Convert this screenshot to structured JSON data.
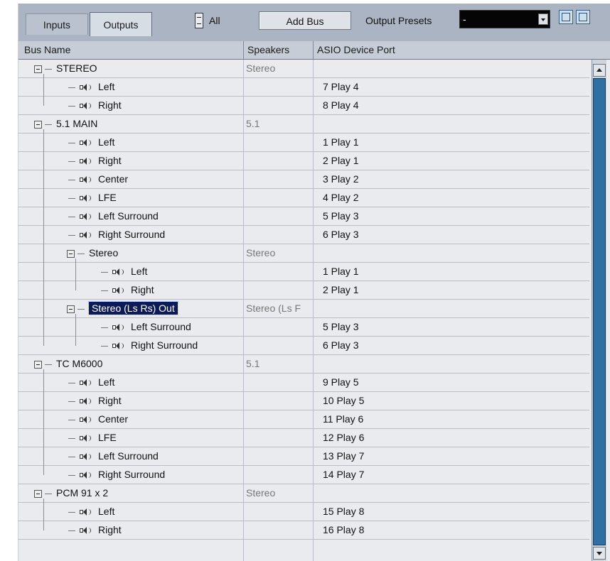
{
  "toolbar": {
    "tabs": [
      {
        "label": "Inputs",
        "active": false
      },
      {
        "label": "Outputs",
        "active": true
      }
    ],
    "all_label": "All",
    "add_bus_label": "Add Bus",
    "presets_label": "Output Presets",
    "presets_value": "-"
  },
  "columns": {
    "bus_name": "Bus Name",
    "speakers": "Speakers",
    "asio_port": "ASIO Device Port"
  },
  "rows": [
    {
      "level": 0,
      "kind": "bus",
      "name": "STEREO",
      "speakers": "Stereo",
      "port": ""
    },
    {
      "level": 1,
      "kind": "channel",
      "name": "Left",
      "speakers": "",
      "port": "7 Play 4"
    },
    {
      "level": 1,
      "kind": "channel",
      "name": "Right",
      "speakers": "",
      "port": "8 Play 4"
    },
    {
      "level": 0,
      "kind": "bus",
      "name": "5.1 MAIN",
      "speakers": "5.1",
      "port": ""
    },
    {
      "level": 1,
      "kind": "channel",
      "name": "Left",
      "speakers": "",
      "port": "1 Play 1"
    },
    {
      "level": 1,
      "kind": "channel",
      "name": "Right",
      "speakers": "",
      "port": "2 Play 1"
    },
    {
      "level": 1,
      "kind": "channel",
      "name": "Center",
      "speakers": "",
      "port": "3 Play 2"
    },
    {
      "level": 1,
      "kind": "channel",
      "name": "LFE",
      "speakers": "",
      "port": "4 Play 2"
    },
    {
      "level": 1,
      "kind": "channel",
      "name": "Left Surround",
      "speakers": "",
      "port": "5 Play 3"
    },
    {
      "level": 1,
      "kind": "channel",
      "name": "Right Surround",
      "speakers": "",
      "port": "6 Play 3"
    },
    {
      "level": 1,
      "kind": "subbus",
      "name": "Stereo",
      "speakers": "Stereo",
      "port": ""
    },
    {
      "level": 2,
      "kind": "channel",
      "name": "Left",
      "speakers": "",
      "port": "1 Play 1"
    },
    {
      "level": 2,
      "kind": "channel",
      "name": "Right",
      "speakers": "",
      "port": "2 Play 1"
    },
    {
      "level": 1,
      "kind": "subbus",
      "name": "Stereo (Ls Rs) Out",
      "speakers": "Stereo (Ls F",
      "port": "",
      "selected": true
    },
    {
      "level": 2,
      "kind": "channel",
      "name": "Left Surround",
      "speakers": "",
      "port": "5 Play 3"
    },
    {
      "level": 2,
      "kind": "channel",
      "name": "Right Surround",
      "speakers": "",
      "port": "6 Play 3"
    },
    {
      "level": 0,
      "kind": "bus",
      "name": "TC M6000",
      "speakers": "5.1",
      "port": ""
    },
    {
      "level": 1,
      "kind": "channel",
      "name": "Left",
      "speakers": "",
      "port": "9 Play 5"
    },
    {
      "level": 1,
      "kind": "channel",
      "name": "Right",
      "speakers": "",
      "port": "10 Play 5"
    },
    {
      "level": 1,
      "kind": "channel",
      "name": "Center",
      "speakers": "",
      "port": "11 Play 6"
    },
    {
      "level": 1,
      "kind": "channel",
      "name": "LFE",
      "speakers": "",
      "port": "12 Play 6"
    },
    {
      "level": 1,
      "kind": "channel",
      "name": "Left Surround",
      "speakers": "",
      "port": "13 Play 7"
    },
    {
      "level": 1,
      "kind": "channel",
      "name": "Right Surround",
      "speakers": "",
      "port": "14 Play 7"
    },
    {
      "level": 0,
      "kind": "bus",
      "name": "PCM 91 x 2",
      "speakers": "Stereo",
      "port": ""
    },
    {
      "level": 1,
      "kind": "channel",
      "name": "Left",
      "speakers": "",
      "port": "15 Play 8"
    },
    {
      "level": 1,
      "kind": "channel",
      "name": "Right",
      "speakers": "",
      "port": "16 Play 8"
    }
  ],
  "colors": {
    "panel": "#aab4c2",
    "selection": "#0c1a55",
    "scroll_thumb": "#2f6fa3"
  }
}
